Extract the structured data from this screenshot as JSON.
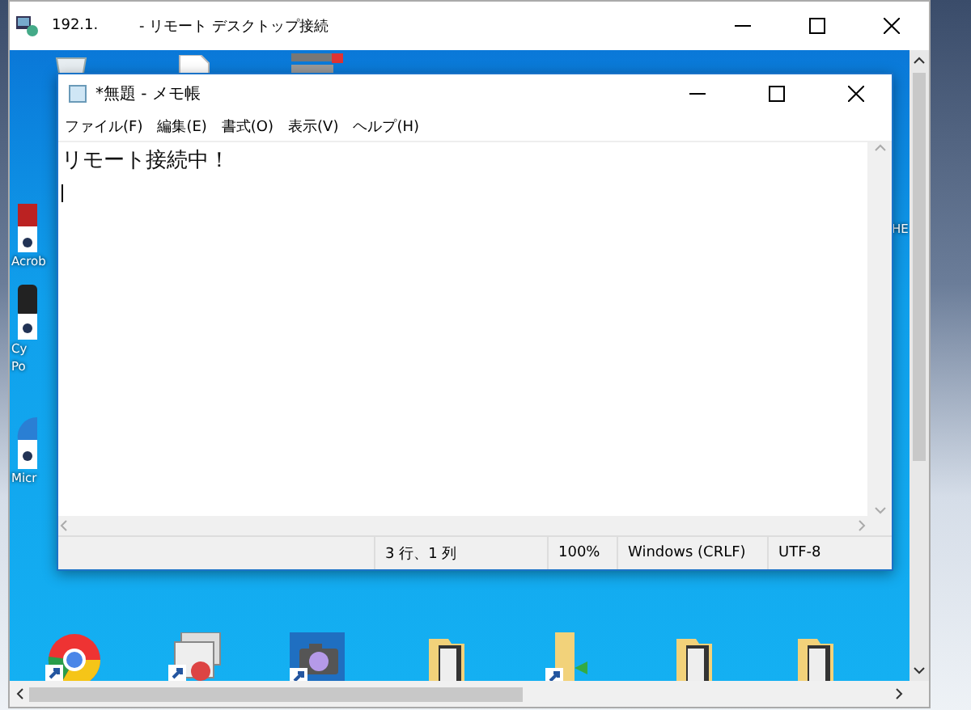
{
  "remote_window": {
    "host": "192.1.",
    "title": "- リモート デスクトップ接続"
  },
  "desktop_icons": [
    {
      "kind": "recycle"
    },
    {
      "kind": "file"
    },
    {
      "kind": "server"
    },
    {
      "kind": "acrobat",
      "lines": [
        "Acrob"
      ]
    },
    {
      "kind": "dark",
      "lines": [
        "Cy",
        "Po"
      ]
    },
    {
      "kind": "edge",
      "lines": [
        "Micr"
      ]
    },
    {
      "kind": "none",
      "lines": [
        "HE"
      ]
    },
    {
      "kind": "chrome"
    },
    {
      "kind": "windows"
    },
    {
      "kind": "camera"
    },
    {
      "kind": "folder"
    },
    {
      "kind": "folder-shortcut"
    },
    {
      "kind": "folder"
    },
    {
      "kind": "folder"
    }
  ],
  "notepad": {
    "title": "*無題 - メモ帳",
    "menu": [
      "ファイル(F)",
      "編集(E)",
      "書式(O)",
      "表示(V)",
      "ヘルプ(H)"
    ],
    "text": "リモート接続中！",
    "status_bar": [
      "3 行、1 列",
      "100%",
      "Windows (CRLF)",
      "UTF-8"
    ]
  }
}
